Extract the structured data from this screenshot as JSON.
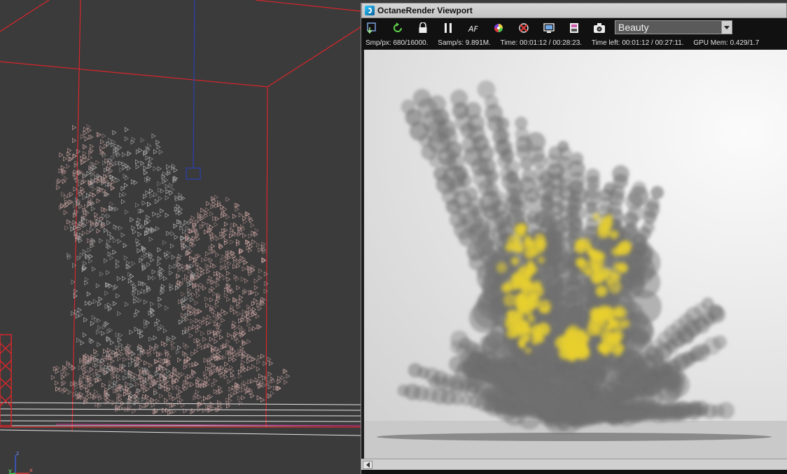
{
  "window": {
    "title": "OctaneRender Viewport"
  },
  "toolbar": {
    "buttons": [
      {
        "name": "send-scene-icon"
      },
      {
        "name": "restart-render-icon"
      },
      {
        "name": "lock-icon"
      },
      {
        "name": "pause-icon"
      },
      {
        "name": "af-focus-icon"
      },
      {
        "name": "color-picker-icon"
      },
      {
        "name": "region-render-icon"
      },
      {
        "name": "display-icon"
      },
      {
        "name": "film-settings-icon"
      },
      {
        "name": "camera-icon"
      }
    ],
    "af_label": "AF",
    "pass": "Beauty"
  },
  "stats": {
    "samples_per_px": "Smp/px: 680/16000.",
    "samples_per_sec": "Samp/s: 9.891M.",
    "time": "Time: 00:01:12 / 00:28:23.",
    "time_left": "Time left: 00:01:12 / 00:27:11.",
    "gpu_mem": "GPU Mem: 0.429/1.7"
  },
  "gizmo": {
    "z": "z",
    "x": "x",
    "y": "y"
  },
  "colors": {
    "bounding_box": "#d8262b",
    "particles_pink": "#c9a3a0",
    "particles_gray": "#b9b9b9",
    "smoke": "#6f6f6f",
    "fire": "#e7cf2f",
    "grid_line": "#e6e6e6"
  }
}
